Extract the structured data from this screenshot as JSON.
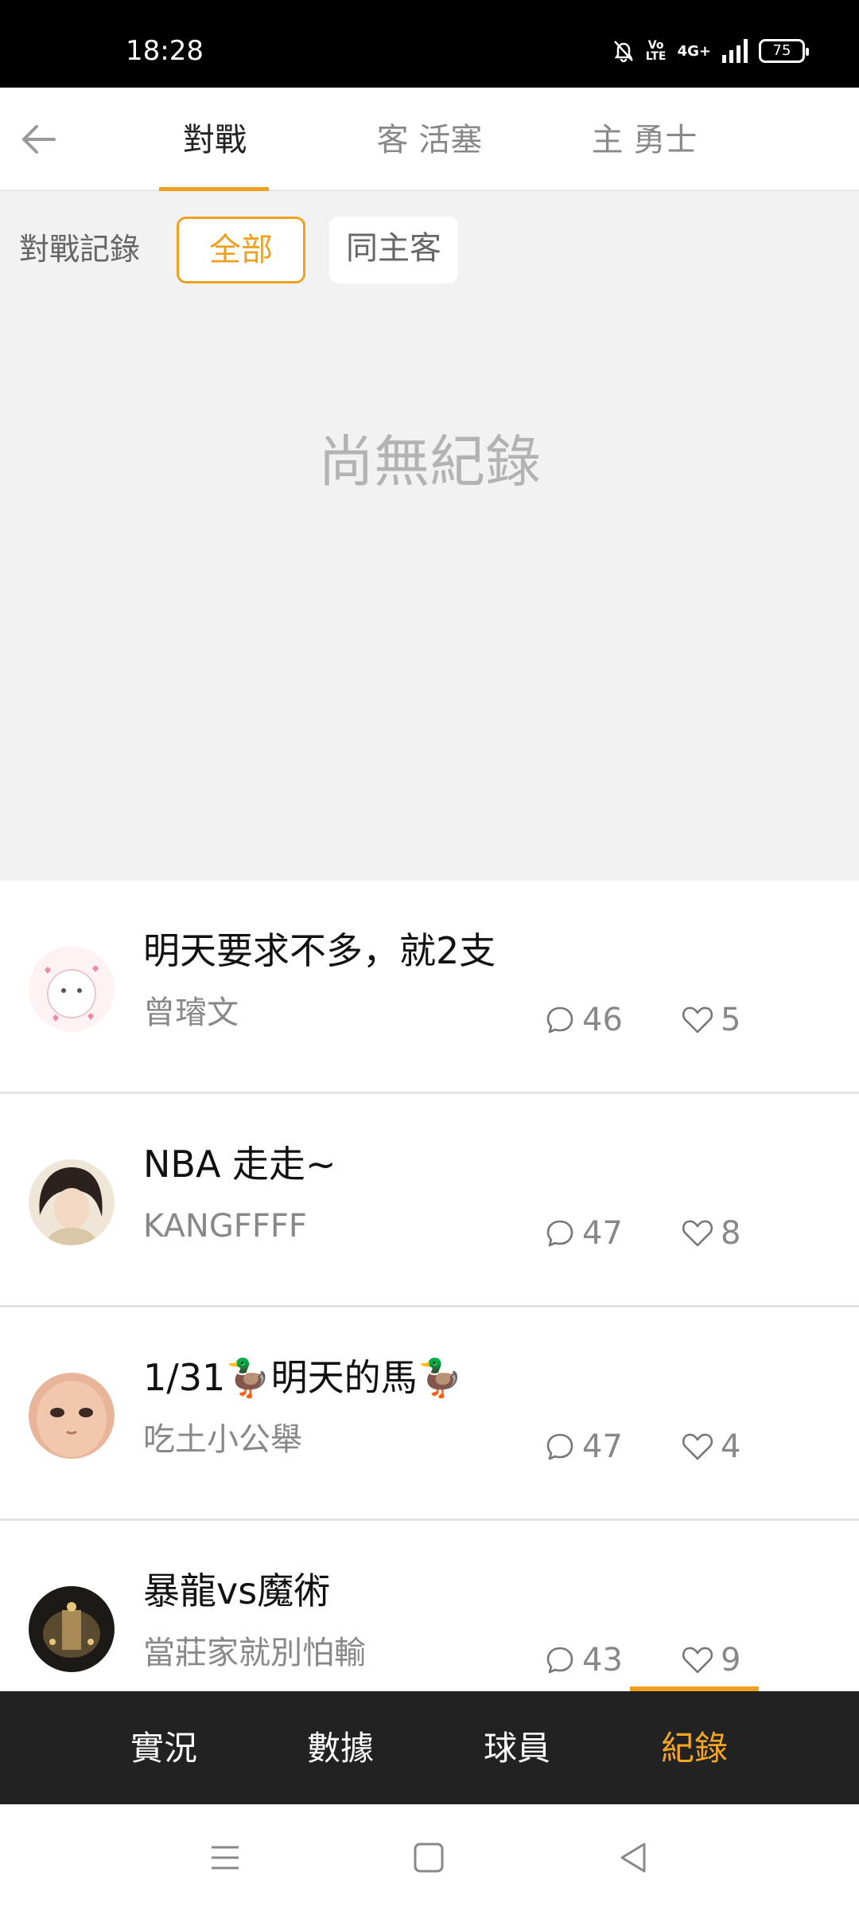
{
  "status_bar": {
    "time": "18:28",
    "network_label": "4G+",
    "volte_label": "Vo LTE",
    "battery": "75",
    "icons": [
      "mute-bell-icon",
      "volte-icon",
      "signal-icon",
      "battery-icon"
    ]
  },
  "top_nav": {
    "back_icon": "back-arrow-icon",
    "tabs": [
      {
        "label": "對戰",
        "active": true
      },
      {
        "label": "客 活塞",
        "active": false
      },
      {
        "label": "主 勇士",
        "active": false
      }
    ]
  },
  "filter": {
    "label": "對戰記錄",
    "options": [
      {
        "label": "全部",
        "active": true
      },
      {
        "label": "同主客",
        "active": false
      }
    ],
    "empty_message": "尚無紀錄"
  },
  "posts": [
    {
      "title": "明天要求不多，就2支",
      "author": "曾璿文",
      "comments": "46",
      "likes": "5"
    },
    {
      "title": "NBA 走走~",
      "author": "KANGFFFF",
      "comments": "47",
      "likes": "8"
    },
    {
      "title": "1/31🦆明天的馬🦆",
      "author": "吃土小公舉",
      "comments": "47",
      "likes": "4"
    },
    {
      "title": "暴龍vs魔術",
      "author": "當莊家就別怕輸",
      "comments": "43",
      "likes": "9"
    }
  ],
  "bottom_tabs": [
    {
      "label": "實況",
      "active": false
    },
    {
      "label": "數據",
      "active": false
    },
    {
      "label": "球員",
      "active": false
    },
    {
      "label": "紀錄",
      "active": true
    }
  ],
  "colors": {
    "accent": "#f0a020",
    "status_bar_bg": "#000000",
    "filter_bg": "#f2f2f2",
    "bottom_bar_bg": "#222222"
  }
}
